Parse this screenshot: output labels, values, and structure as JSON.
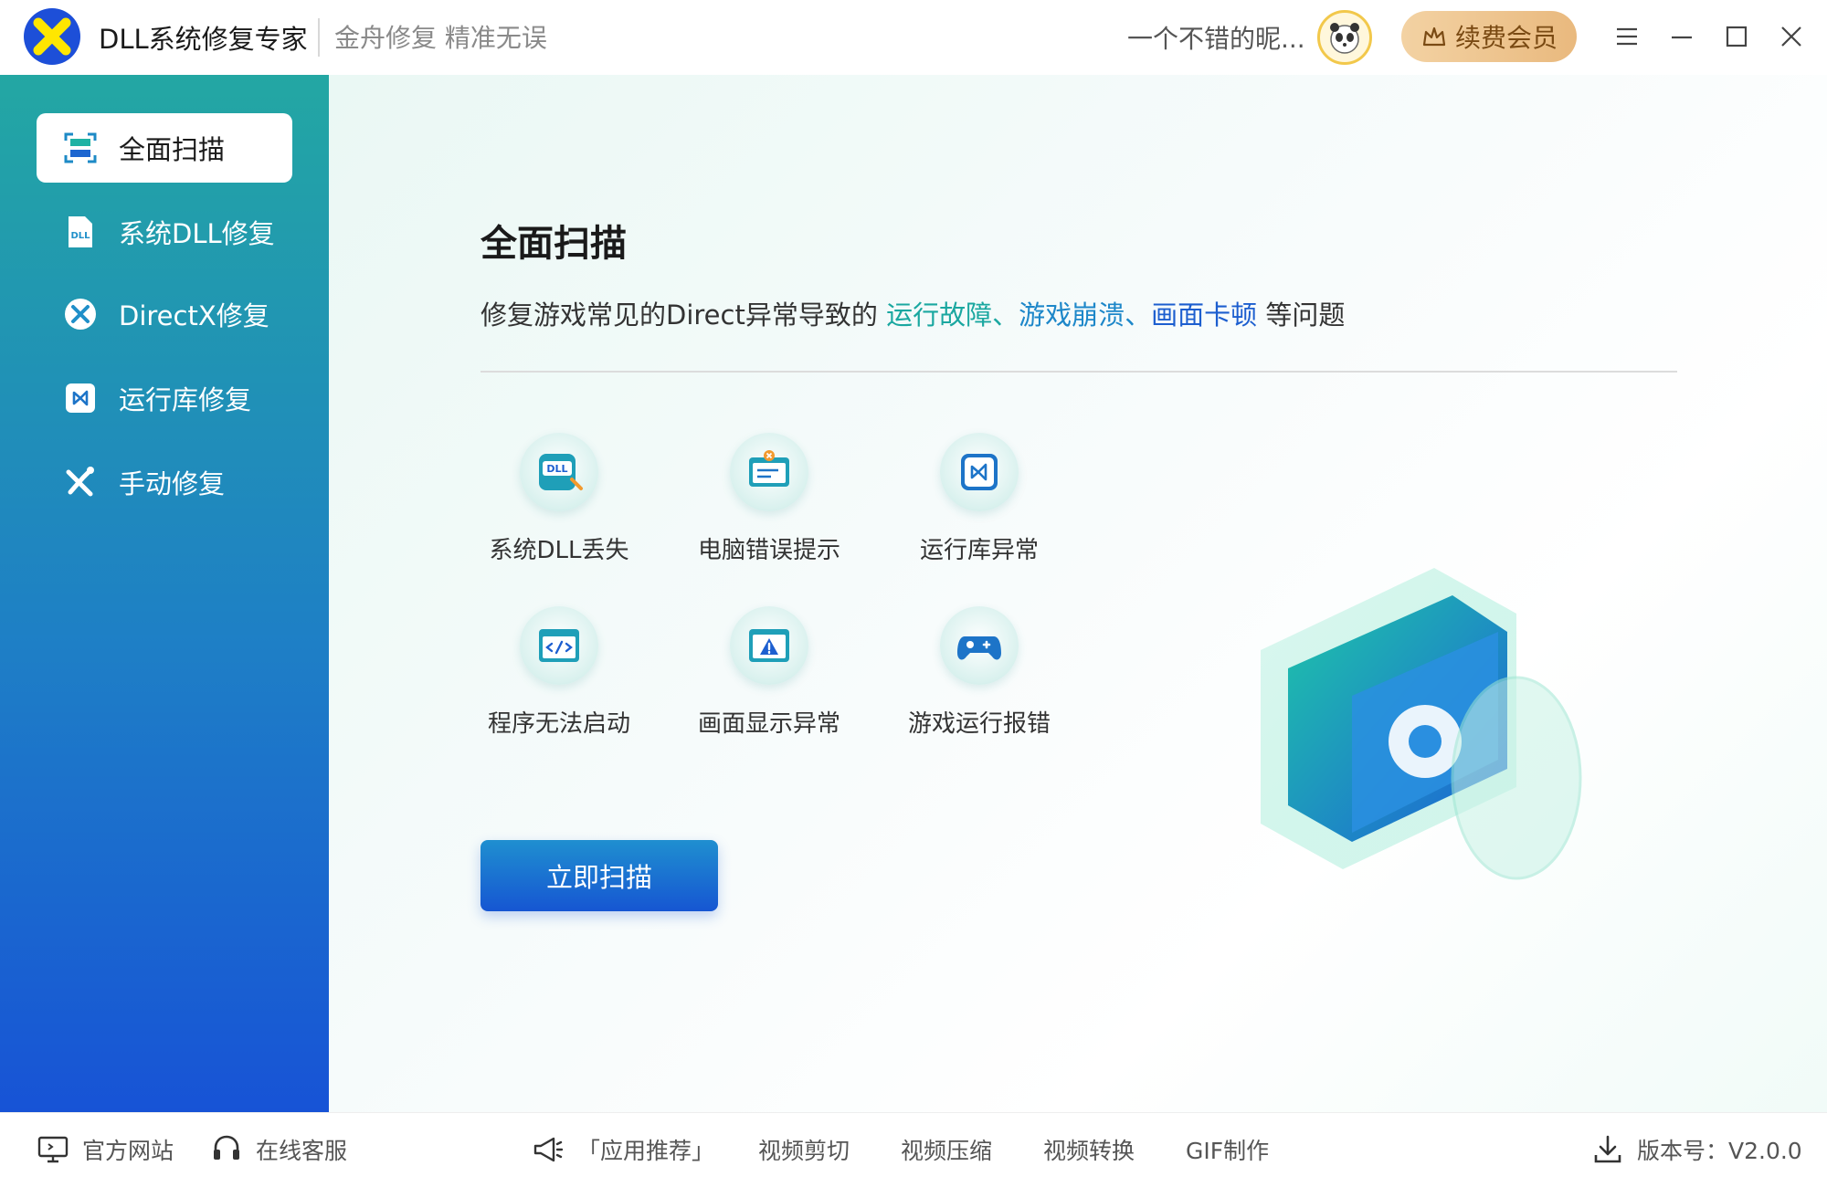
{
  "app": {
    "title": "DLL系统修复专家",
    "slogan": "金舟修复 精准无误",
    "logo_icon": "x-logo-icon"
  },
  "user": {
    "name": "一个不错的昵...",
    "avatar_icon": "panda-avatar-icon",
    "vip_label": "续费会员"
  },
  "window_controls": [
    "menu-icon",
    "minimize-icon",
    "maximize-icon",
    "close-icon"
  ],
  "sidebar": {
    "items": [
      {
        "label": "全面扫描",
        "icon": "scan-icon",
        "active": true
      },
      {
        "label": "系统DLL修复",
        "icon": "dll-file-icon",
        "active": false
      },
      {
        "label": "DirectX修复",
        "icon": "directx-icon",
        "active": false
      },
      {
        "label": "运行库修复",
        "icon": "runtime-icon",
        "active": false
      },
      {
        "label": "手动修复",
        "icon": "tools-icon",
        "active": false
      }
    ]
  },
  "main": {
    "title": "全面扫描",
    "desc_prefix": "修复游戏常见的Direct异常导致的 ",
    "desc_hl1": "运行故障、",
    "desc_hl2": "游戏崩溃、",
    "desc_hl3": "画面卡顿",
    "desc_suffix": " 等问题",
    "features": [
      {
        "label": "系统DLL丢失",
        "icon": "dll-missing-icon"
      },
      {
        "label": "电脑错误提示",
        "icon": "error-prompt-icon"
      },
      {
        "label": "运行库异常",
        "icon": "runtime-error-icon"
      },
      {
        "label": "程序无法启动",
        "icon": "program-launch-icon"
      },
      {
        "label": "画面显示异常",
        "icon": "display-warning-icon"
      },
      {
        "label": "游戏运行报错",
        "icon": "gamepad-icon"
      }
    ],
    "scan_button": "立即扫描",
    "hero_icon": "gear-cube-illustration"
  },
  "footer": {
    "website": "官方网站",
    "support": "在线客服",
    "recommend": "「应用推荐」",
    "links": [
      "视频剪切",
      "视频压缩",
      "视频转换",
      "GIF制作"
    ],
    "version": "版本号：V2.0.0"
  },
  "colors": {
    "sidebar_top": "#23a7a3",
    "sidebar_bottom": "#1753d6",
    "accent_blue": "#1656d2",
    "vip_gold": "#e9b97e"
  }
}
